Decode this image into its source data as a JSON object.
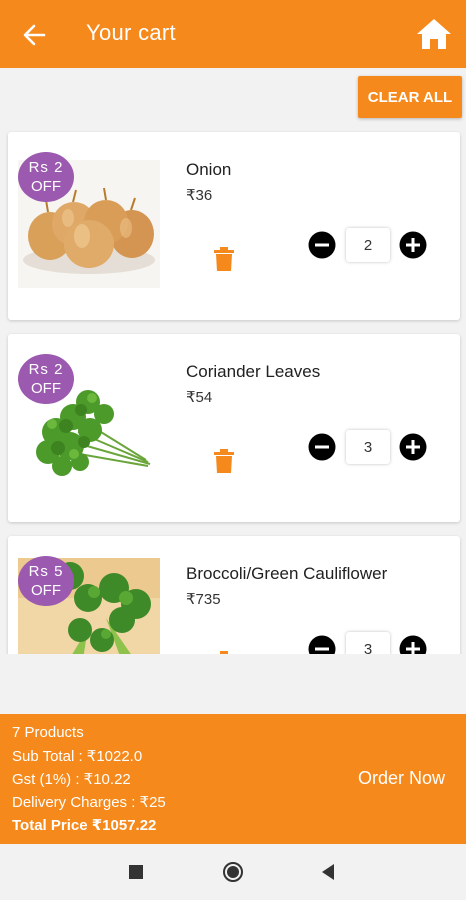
{
  "header": {
    "title": "Your cart",
    "back_icon": "arrow-left-icon",
    "home_icon": "home-icon"
  },
  "actions": {
    "clear_all": "CLEAR ALL"
  },
  "cart_items": [
    {
      "name": "Onion",
      "price": "₹36",
      "badge_line1": "Rs 2",
      "badge_line2": "OFF",
      "quantity": "2",
      "image": "onion"
    },
    {
      "name": "Coriander Leaves",
      "price": "₹54",
      "badge_line1": "Rs 2",
      "badge_line2": "OFF",
      "quantity": "3",
      "image": "coriander"
    },
    {
      "name": "Broccoli/Green Cauliflower",
      "price": "₹735",
      "badge_line1": "Rs 5",
      "badge_line2": "OFF",
      "quantity": "3",
      "image": "broccoli"
    }
  ],
  "summary": {
    "products": "7 Products",
    "sub_total": "Sub Total : ₹1022.0",
    "gst": "Gst (1%) : ₹10.22",
    "delivery": "Delivery Charges : ₹25",
    "total": "Total Price ₹1057.22",
    "order_now": "Order Now"
  },
  "colors": {
    "accent": "#f5891b",
    "badge": "#9b5ab0",
    "trash": "#f5891b"
  }
}
